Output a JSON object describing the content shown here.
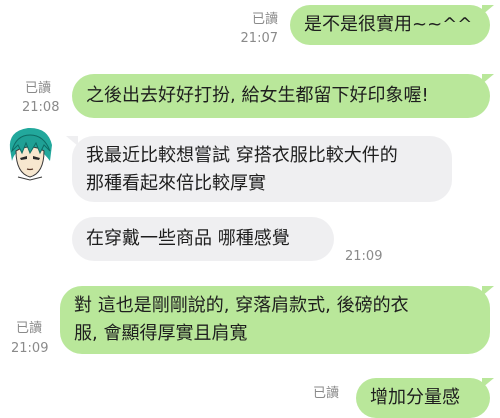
{
  "chat": {
    "messages": [
      {
        "id": "m1",
        "direction": "out",
        "text": "是不是很實用~~^^",
        "read": "已讀",
        "time": "21:07"
      },
      {
        "id": "m2",
        "direction": "out",
        "text": "之後出去好好打扮, 給女生都留下好印象喔!",
        "read": "已讀",
        "time": "21:08"
      },
      {
        "id": "m3",
        "direction": "in",
        "lines": [
          "我最近比較想嘗試 穿搭衣服比較大件的",
          "那種看起來倍比較厚實"
        ],
        "time": ""
      },
      {
        "id": "m4",
        "direction": "in",
        "text": "在穿戴一些商品 哪種感覺",
        "time": "21:09"
      },
      {
        "id": "m5",
        "direction": "out",
        "lines": [
          "對 這也是剛剛說的, 穿落肩款式, 後磅的衣",
          "服, 會顯得厚實且肩寬"
        ],
        "read": "已讀",
        "time": "21:09"
      },
      {
        "id": "m6",
        "direction": "out",
        "text": "增加分量感",
        "read": "已讀",
        "time": ""
      }
    ]
  },
  "colors": {
    "outgoing_bubble": "#b9e79a",
    "incoming_bubble": "#efeff1",
    "meta_text": "#8a8a8a"
  },
  "icons": {
    "avatar": "anime-character-avatar-teal-hair"
  }
}
